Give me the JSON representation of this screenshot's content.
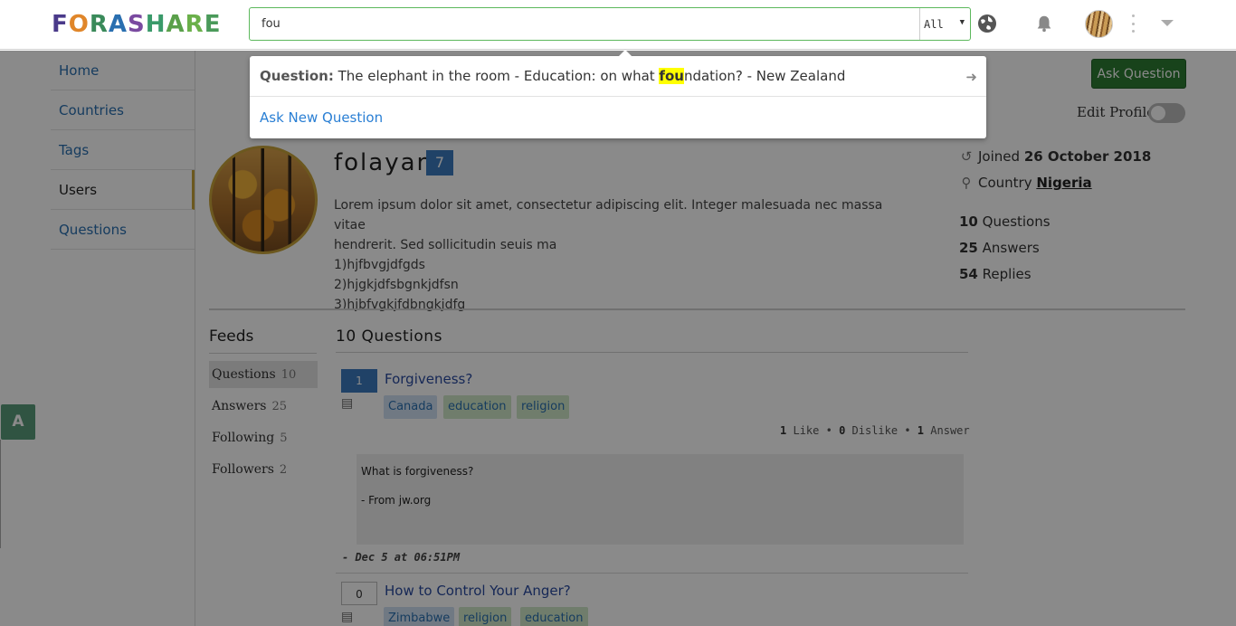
{
  "header": {
    "logo_letters": [
      "F",
      "O",
      "R",
      "A",
      "S",
      "H",
      "A",
      "R",
      "E"
    ],
    "search": {
      "value": "fou",
      "placeholder": ""
    },
    "scope": "All",
    "icons": [
      "globe-icon",
      "bell-icon",
      "kebab-icon",
      "chevron-down-icon"
    ]
  },
  "search_dropdown": {
    "result": {
      "label": "Question:",
      "text_before": " The elephant in the room - Education: on what ",
      "highlight": "fou",
      "text_after": "ndation? - New Zealand"
    },
    "ask_new": "Ask New Question"
  },
  "nav": {
    "items": [
      {
        "label": "Home"
      },
      {
        "label": "Countries"
      },
      {
        "label": "Tags"
      },
      {
        "label": "Users"
      },
      {
        "label": "Questions"
      }
    ],
    "active": "Users"
  },
  "actions": {
    "ask_question": "Ask Question",
    "edit_profile": "Edit Profile"
  },
  "profile": {
    "username": "folayan",
    "badge": "7",
    "bio": [
      "Lorem ipsum dolor sit amet, consectetur adipiscing elit. Integer malesuada nec massa vitae",
      "hendrerit. Sed sollicitudin seuis ma",
      "1)hjfbvgjdfgds",
      "2)hjgkjdfsbgnkjdfsn",
      "3)hjbfvgkjfdbngkjdfg"
    ],
    "joined_label": "Joined",
    "joined_date": "26 October 2018",
    "country_label": "Country",
    "country": "Nigeria",
    "stats": [
      {
        "count": "10",
        "label": "Questions"
      },
      {
        "count": "25",
        "label": "Answers"
      },
      {
        "count": "54",
        "label": "Replies"
      }
    ]
  },
  "feeds": {
    "title": "Feeds",
    "items": [
      {
        "label": "Questions",
        "count": "10"
      },
      {
        "label": "Answers",
        "count": "25"
      },
      {
        "label": "Following",
        "count": "5"
      },
      {
        "label": "Followers",
        "count": "2"
      }
    ]
  },
  "questions": {
    "header": "10 Questions",
    "list": [
      {
        "votes": "1",
        "title": "Forgiveness?",
        "tags": [
          "Canada",
          "education",
          "religion"
        ],
        "likes": "1",
        "like_label": "Like",
        "dislikes": "0",
        "dislike_label": "Dislike",
        "answers": "1",
        "answer_label": "Answer",
        "body": [
          "What is forgiveness?",
          "",
          "- From jw.org"
        ],
        "date": "- Dec 5 at 06:51PM"
      },
      {
        "votes": "0",
        "title": "How to Control Your Anger?",
        "tags": [
          "Zimbabwe",
          "religion",
          "education"
        ]
      }
    ]
  },
  "floating": {
    "a_button": "A"
  },
  "colors": {
    "accent_green": "#2e7d32",
    "link_blue": "#2a6fb0",
    "badge_blue": "#3b7bbf",
    "highlight": "#ffff00"
  }
}
